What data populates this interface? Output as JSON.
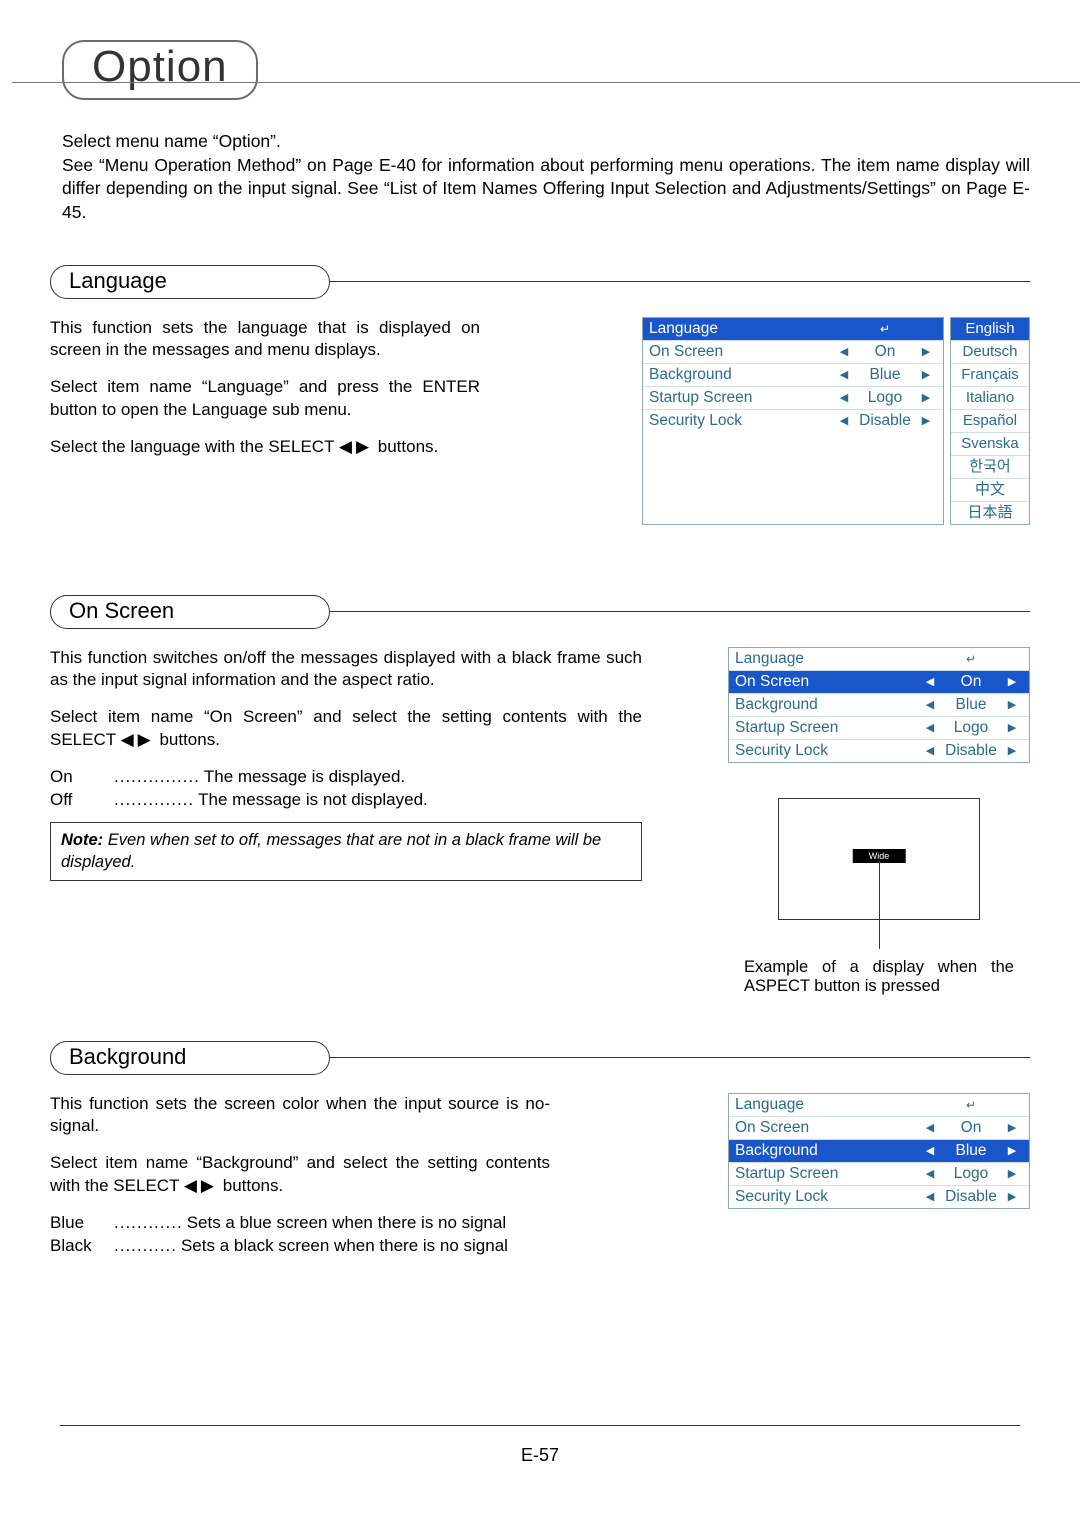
{
  "title": "Option",
  "intro_line1": "Select menu name “Option”.",
  "intro_line2": "See “Menu Operation Method” on Page E-40 for information about performing menu operations. The item name display will differ depending on the input signal. See “List of Item Names Offering Input Selection and Adjustments/Settings” on Page E-45.",
  "sections": {
    "language": {
      "heading": "Language",
      "p1": "This function sets the language that is displayed on screen in the messages and menu displays.",
      "p2": "Select item name “Language” and press the ENTER button to open the Language sub menu.",
      "p3_pre": "Select the language with the SELECT ",
      "p3_post": " buttons.",
      "osd": {
        "rows": [
          {
            "label": "Language",
            "val": "",
            "enter": true,
            "sel": true
          },
          {
            "label": "On Screen",
            "val": "On"
          },
          {
            "label": "Background",
            "val": "Blue"
          },
          {
            "label": "Startup Screen",
            "val": "Logo"
          },
          {
            "label": "Security Lock",
            "val": "Disable"
          }
        ]
      },
      "lang_options": [
        "English",
        "Deutsch",
        "Français",
        "Italiano",
        "Español",
        "Svenska",
        "한국어",
        "中文",
        "日本語"
      ],
      "lang_selected_index": 0
    },
    "onscreen": {
      "heading": "On Screen",
      "p1": "This function switches on/off the messages displayed with a black frame such as the input signal information and the aspect ratio.",
      "p2_pre": "Select item name “On Screen” and select the setting contents with the SELECT ",
      "p2_post": " buttons.",
      "opt_on": "The message is displayed.",
      "opt_off": "The message is not displayed.",
      "note_title": "Note:",
      "note_body": "Even when set to off, messages that are not in a black frame will be displayed.",
      "osd": {
        "rows": [
          {
            "label": "Language",
            "val": "",
            "enter": true
          },
          {
            "label": "On Screen",
            "val": "On",
            "sel": true
          },
          {
            "label": "Background",
            "val": "Blue"
          },
          {
            "label": "Startup Screen",
            "val": "Logo"
          },
          {
            "label": "Security Lock",
            "val": "Disable"
          }
        ]
      },
      "wide_label": "Wide",
      "wide_caption": "Example of a display when the ASPECT button is pressed"
    },
    "background": {
      "heading": "Background",
      "p1": "This function sets the screen color when the input source is no-signal.",
      "p2_pre": "Select item name “Background” and select the setting contents with the SELECT ",
      "p2_post": " buttons.",
      "opt_blue": "Sets a blue screen when there is no signal",
      "opt_black": "Sets a black screen when there is no signal",
      "osd": {
        "rows": [
          {
            "label": "Language",
            "val": "",
            "enter": true
          },
          {
            "label": "On Screen",
            "val": "On"
          },
          {
            "label": "Background",
            "val": "Blue",
            "sel": true
          },
          {
            "label": "Startup Screen",
            "val": "Logo"
          },
          {
            "label": "Security Lock",
            "val": "Disable"
          }
        ]
      }
    }
  },
  "labels": {
    "on": "On",
    "off": "Off",
    "blue": "Blue",
    "black": "Black"
  },
  "page_number": "E-57"
}
